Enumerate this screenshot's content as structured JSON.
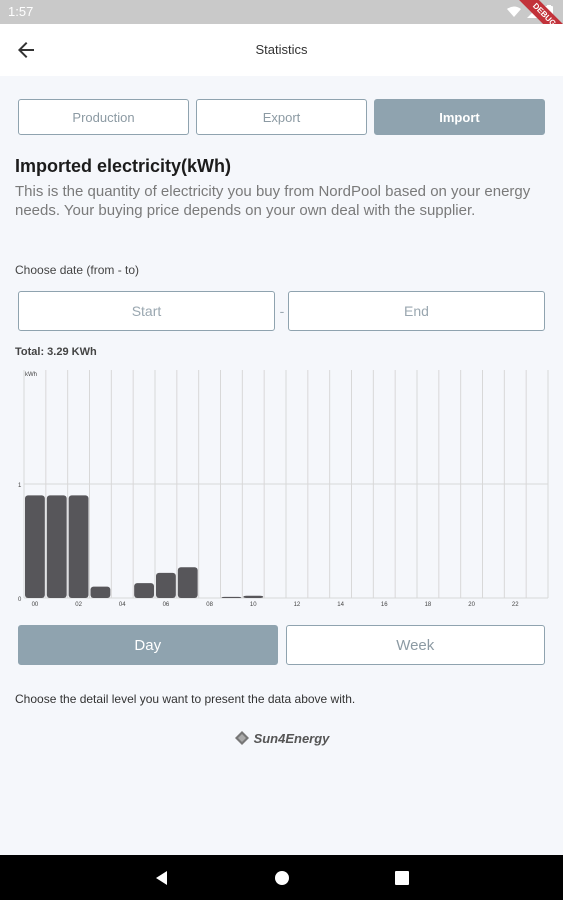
{
  "status_bar": {
    "time": "1:57",
    "debug_label": "DEBUG"
  },
  "app_bar": {
    "title": "Statistics"
  },
  "tabs": [
    {
      "label": "Production",
      "active": false
    },
    {
      "label": "Export",
      "active": false
    },
    {
      "label": "Import",
      "active": true
    }
  ],
  "heading": "Imported electricity(kWh)",
  "description": "This is the quantity of electricity you buy from NordPool based on your energy needs. Your buying price depends on your own deal with the supplier.",
  "date_range": {
    "label": "Choose date (from - to)",
    "start_label": "Start",
    "separator": "-",
    "end_label": "End"
  },
  "total": "Total: 3.29 KWh",
  "chart_data": {
    "type": "bar",
    "ylabel": "kWh",
    "ylim": [
      0,
      2
    ],
    "y_ticks": [
      "0",
      "1"
    ],
    "x_ticks": [
      "00",
      "02",
      "04",
      "06",
      "08",
      "10",
      "12",
      "14",
      "16",
      "18",
      "20",
      "22"
    ],
    "categories": [
      "00",
      "01",
      "02",
      "03",
      "04",
      "05",
      "06",
      "07",
      "08",
      "09",
      "10",
      "11",
      "12",
      "13",
      "14",
      "15",
      "16",
      "17",
      "18",
      "19",
      "20",
      "21",
      "22",
      "23"
    ],
    "values": [
      0.9,
      0.9,
      0.9,
      0.1,
      0,
      0.13,
      0.22,
      0.27,
      0,
      0.01,
      0.02,
      0,
      0,
      0,
      0,
      0,
      0,
      0,
      0,
      0,
      0,
      0,
      0,
      0
    ],
    "bar_color": "#57565a",
    "grid": true
  },
  "period": [
    {
      "label": "Day",
      "active": true
    },
    {
      "label": "Week",
      "active": false
    }
  ],
  "hint": "Choose the detail level you want to present the data above with.",
  "brand": {
    "name": "Sun4Energy"
  },
  "colors": {
    "accent": "#8fa3af",
    "background": "#f5f7fb"
  }
}
